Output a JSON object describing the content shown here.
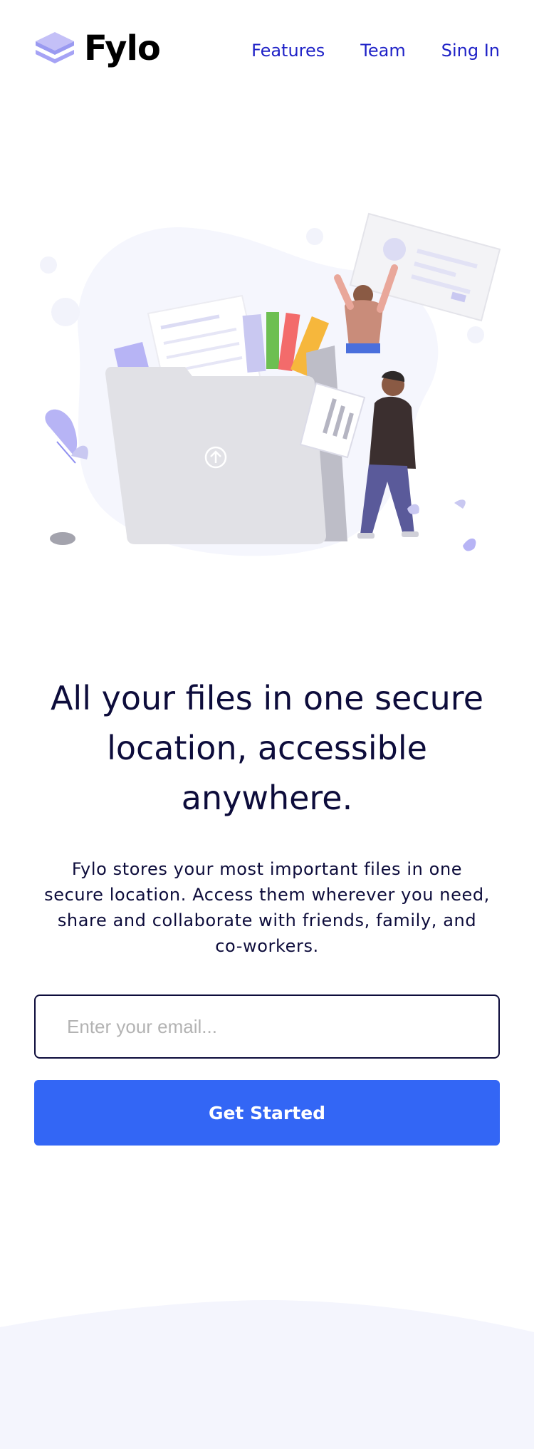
{
  "header": {
    "logo_text": "Fylo",
    "nav": [
      {
        "label": "Features"
      },
      {
        "label": "Team"
      },
      {
        "label": "Sing In"
      }
    ]
  },
  "hero": {
    "title": "All your files in one secure location, accessible anywhere.",
    "description": "Fylo stores your most important files in one secure location. Access them wherever you need, share and collaborate with friends, family, and co-workers."
  },
  "signup": {
    "email_placeholder": "Enter your email...",
    "email_value": "",
    "button_label": "Get Started"
  },
  "colors": {
    "brand_purple": "#8f8ff0",
    "nav_link": "#1f22c7",
    "heading": "#0d0c3b",
    "cta": "#3366f5",
    "footer_bg": "#f4f5fd"
  },
  "icons": {
    "logo": "stacked-layers-icon",
    "upload": "upload-arrow-icon"
  }
}
